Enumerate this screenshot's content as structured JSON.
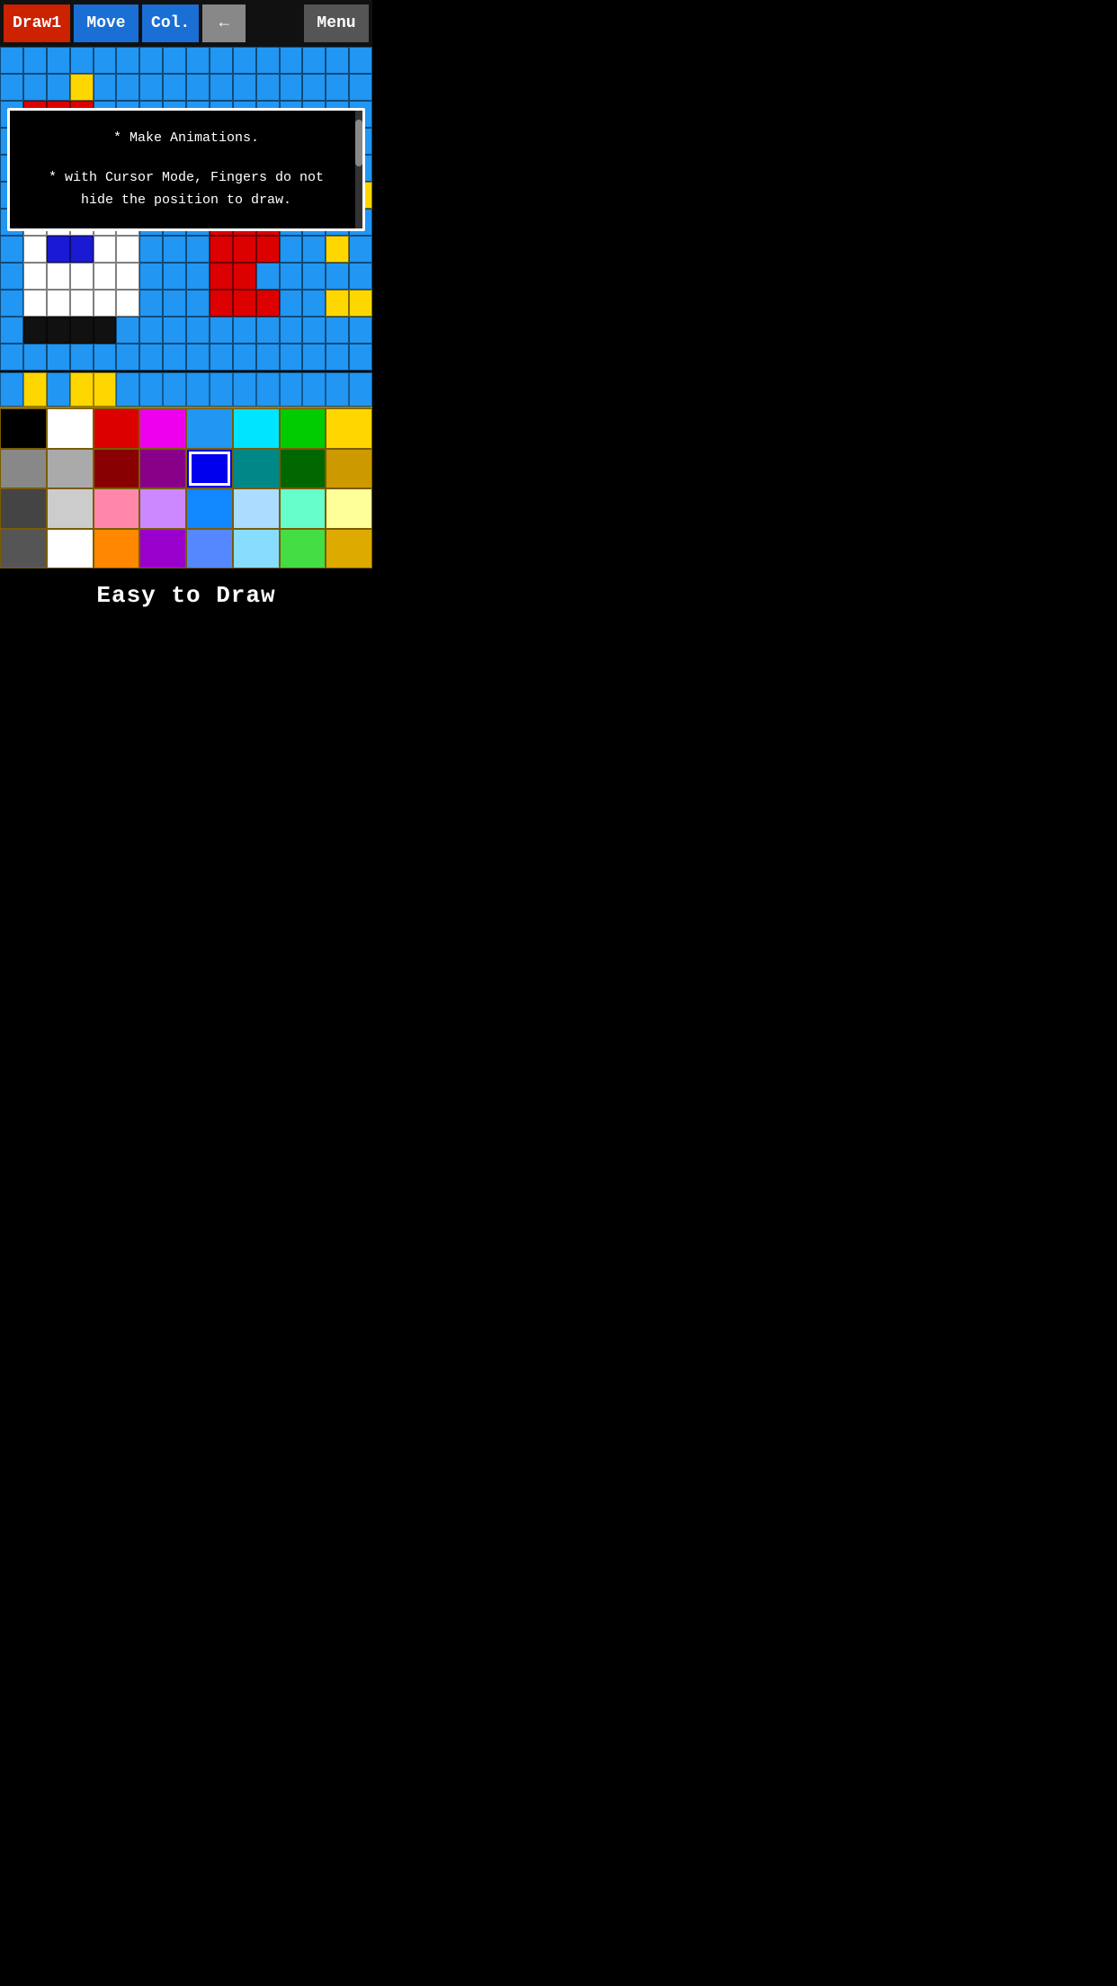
{
  "toolbar": {
    "draw_label": "Draw1",
    "move_label": "Move",
    "col_label": "Col.",
    "back_label": "←",
    "menu_label": "Menu"
  },
  "info_box": {
    "line1": "* Make Animations.",
    "line2": "* with Cursor Mode, Fingers do not",
    "line3": "  hide the position to draw."
  },
  "palette_row": {
    "colors": [
      "#2196f3",
      "#f5c300",
      "#2196f3",
      "#f5c300",
      "#f5c300",
      "#2196f3",
      "#2196f3",
      "#2196f3",
      "#2196f3",
      "#2196f3",
      "#2196f3",
      "#2196f3",
      "#2196f3",
      "#2196f3",
      "#2196f3",
      "#2196f3"
    ]
  },
  "palette": {
    "colors": [
      "#000000",
      "#ffffff",
      "#dd0000",
      "#ee00ee",
      "#2196f3",
      "#00e5ff",
      "#00cc00",
      "#ffd700",
      "#888888",
      "#aaaaaa",
      "#880000",
      "#880088",
      "#0000ee",
      "#008888",
      "#006600",
      "#cc9900",
      "#444444",
      "#cccccc",
      "#ff88aa",
      "#cc88ff",
      "#1188ff",
      "#aaddff",
      "#66ffcc",
      "#ffff99",
      "#555555",
      "#ffffff",
      "#ff8800",
      "#9900cc",
      "#5588ff",
      "#88ddff",
      "#44dd44",
      "#ddaa00"
    ],
    "selected_index": 12
  },
  "bottom_label": "Easy to Draw",
  "pixel_grid": {
    "cols": 16,
    "rows": 12,
    "cells": [
      "blue",
      "blue",
      "blue",
      "blue",
      "blue",
      "blue",
      "blue",
      "blue",
      "blue",
      "blue",
      "blue",
      "blue",
      "blue",
      "blue",
      "blue",
      "blue",
      "blue",
      "blue",
      "blue",
      "yellow",
      "blue",
      "blue",
      "blue",
      "blue",
      "blue",
      "blue",
      "blue",
      "blue",
      "blue",
      "blue",
      "blue",
      "blue",
      "blue",
      "red",
      "red",
      "red",
      "blue",
      "blue",
      "blue",
      "blue",
      "blue",
      "blue",
      "blue",
      "blue",
      "blue",
      "blue",
      "blue",
      "blue",
      "blue",
      "red",
      "red",
      "red",
      "red",
      "blue",
      "blue",
      "blue",
      "blue",
      "blue",
      "blue",
      "black",
      "blue",
      "blue",
      "blue",
      "blue",
      "blue",
      "red",
      "red",
      "red",
      "red",
      "blue",
      "blue",
      "blue",
      "blue",
      "blue",
      "white",
      "white",
      "white",
      "blue",
      "yellow",
      "blue",
      "blue",
      "white",
      "white",
      "white",
      "white",
      "white",
      "blue",
      "blue",
      "blue",
      "red",
      "red",
      "red",
      "blue",
      "blue",
      "yellow",
      "yellow",
      "blue",
      "white",
      "white",
      "white",
      "white",
      "white",
      "blue",
      "blue",
      "blue",
      "red",
      "red",
      "red",
      "blue",
      "blue",
      "blue",
      "blue",
      "blue",
      "white",
      "blue2",
      "blue2",
      "white",
      "white",
      "blue",
      "blue",
      "blue",
      "red",
      "red",
      "red",
      "blue",
      "blue",
      "yellow",
      "blue",
      "blue",
      "white",
      "white",
      "white",
      "white",
      "white",
      "blue",
      "blue",
      "blue",
      "red",
      "red",
      "blue",
      "blue",
      "blue",
      "blue",
      "blue",
      "blue",
      "white",
      "white",
      "white",
      "white",
      "white",
      "blue",
      "blue",
      "blue",
      "red",
      "red",
      "red",
      "blue",
      "blue",
      "yellow",
      "yellow",
      "blue",
      "black",
      "black",
      "black",
      "black",
      "blue",
      "blue",
      "blue",
      "blue",
      "blue",
      "blue",
      "blue",
      "blue",
      "blue",
      "blue",
      "blue",
      "blue",
      "blue",
      "blue",
      "blue",
      "blue",
      "blue",
      "blue",
      "blue",
      "blue",
      "blue",
      "blue",
      "blue",
      "blue",
      "blue",
      "blue",
      "blue"
    ]
  }
}
